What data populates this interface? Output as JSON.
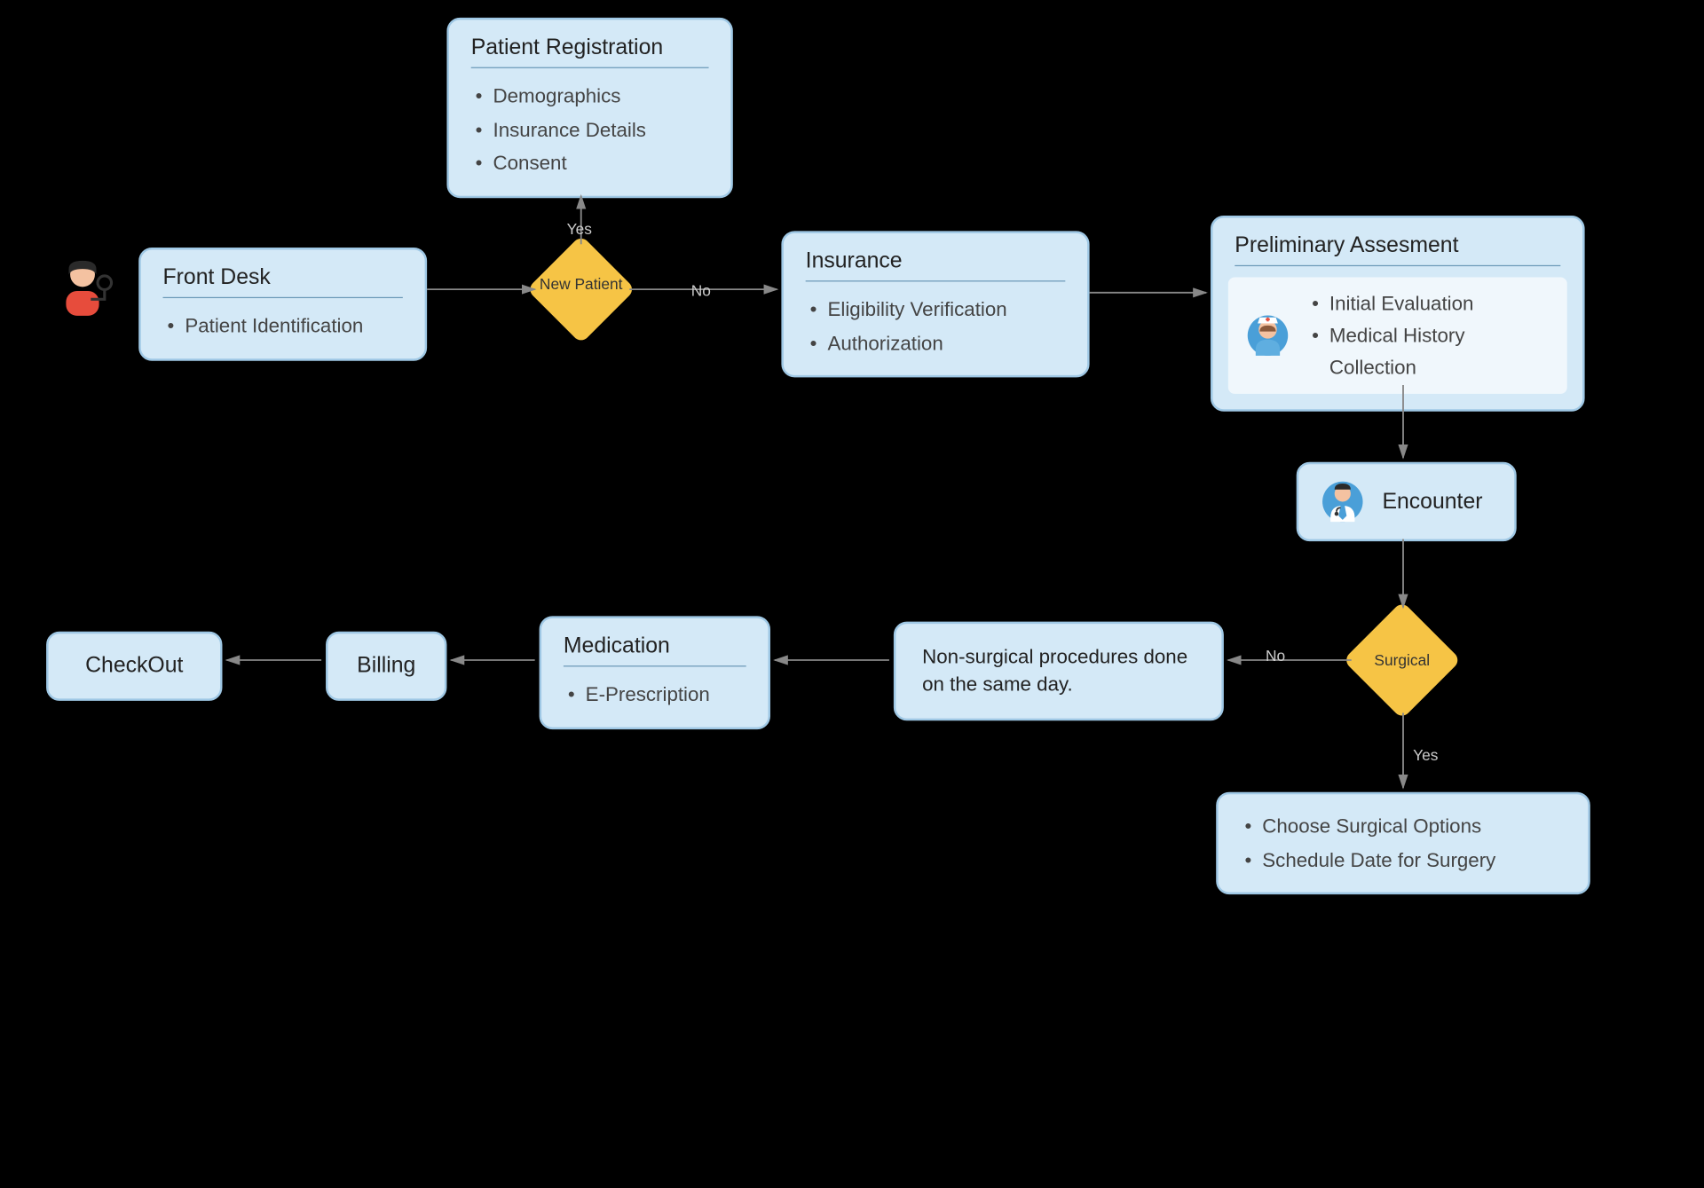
{
  "nodes": {
    "frontDesk": {
      "title": "Front Desk",
      "items": [
        "Patient Identification"
      ]
    },
    "registration": {
      "title": "Patient Registration",
      "items": [
        "Demographics",
        "Insurance Details",
        "Consent"
      ]
    },
    "insurance": {
      "title": "Insurance",
      "items": [
        "Eligibility Verification",
        "Authorization"
      ]
    },
    "assessment": {
      "title": "Preliminary Assesment",
      "items": [
        "Initial Evaluation",
        "Medical History Collection"
      ]
    },
    "encounter": {
      "label": "Encounter"
    },
    "nonSurgical": {
      "text": "Non-surgical procedures done on the same day."
    },
    "surgicalOptions": {
      "items": [
        "Choose Surgical Options",
        "Schedule Date for Surgery"
      ]
    },
    "medication": {
      "title": "Medication",
      "items": [
        "E-Prescription"
      ]
    },
    "billing": {
      "label": "Billing"
    },
    "checkout": {
      "label": "CheckOut"
    }
  },
  "decisions": {
    "newPatient": {
      "label": "New Patient",
      "yes": "Yes",
      "no": "No"
    },
    "surgical": {
      "label": "Surgical",
      "yes": "Yes",
      "no": "No"
    }
  }
}
